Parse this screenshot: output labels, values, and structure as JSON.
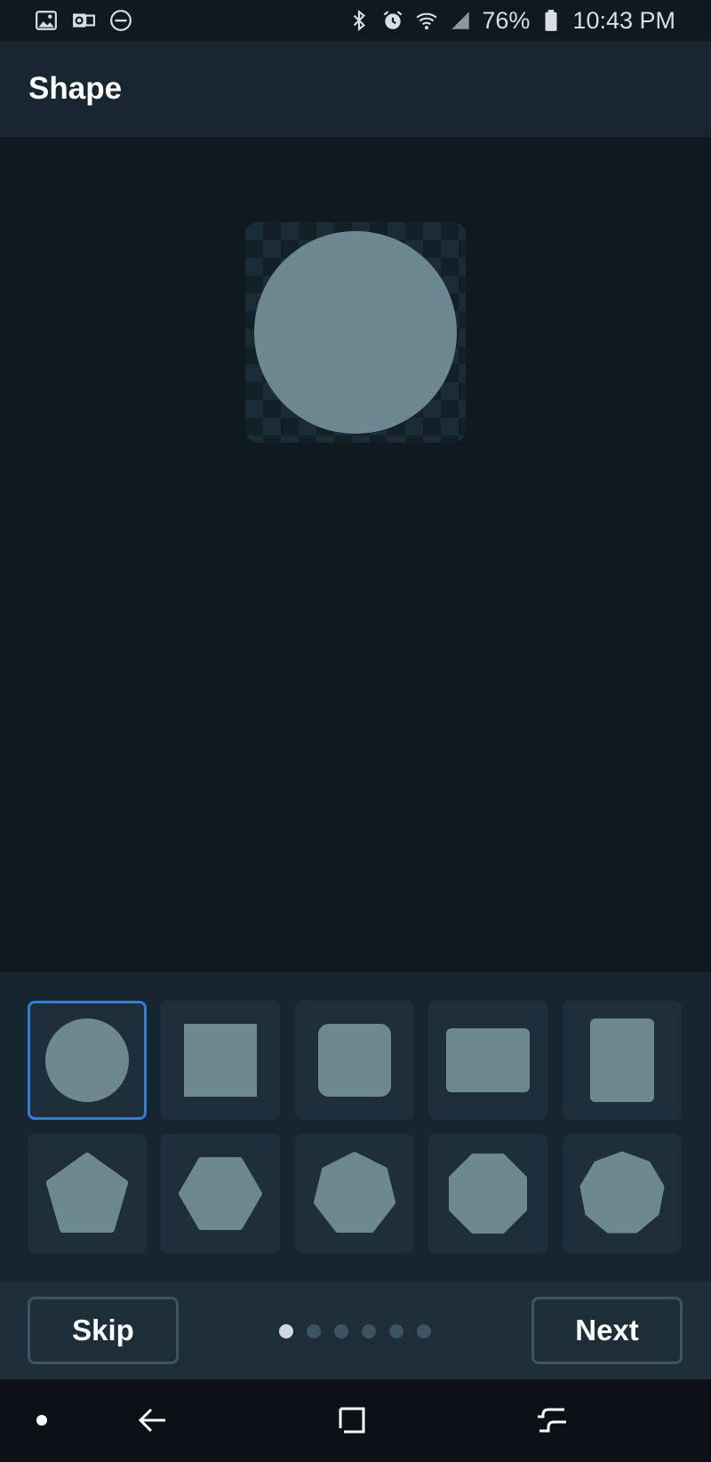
{
  "status_bar": {
    "left_icons": [
      "image-icon",
      "outlook-icon",
      "do-not-disturb-icon"
    ],
    "right_icons": [
      "bluetooth-icon",
      "alarm-icon",
      "wifi-icon",
      "signal-icon"
    ],
    "battery": "76%",
    "time": "10:43 PM"
  },
  "app_bar": {
    "title": "Shape"
  },
  "preview": {
    "shape": "circle",
    "shape_color": "#6d8890"
  },
  "shapes": [
    {
      "name": "circle",
      "selected": true
    },
    {
      "name": "square",
      "selected": false
    },
    {
      "name": "rounded-square",
      "selected": false
    },
    {
      "name": "landscape-rectangle",
      "selected": false
    },
    {
      "name": "portrait-rectangle",
      "selected": false
    },
    {
      "name": "pentagon",
      "selected": false
    },
    {
      "name": "hexagon",
      "selected": false
    },
    {
      "name": "heptagon",
      "selected": false
    },
    {
      "name": "octagon",
      "selected": false
    },
    {
      "name": "nonagon",
      "selected": false
    }
  ],
  "actions": {
    "skip_label": "Skip",
    "next_label": "Next",
    "page_count": 6,
    "current_page": 1
  },
  "colors": {
    "accent": "#2f7fd6",
    "shape": "#6d8890",
    "background": "#101820"
  },
  "nav_bar": {
    "items": [
      "dot-icon",
      "back-icon",
      "recents-icon",
      "home-icon"
    ]
  }
}
